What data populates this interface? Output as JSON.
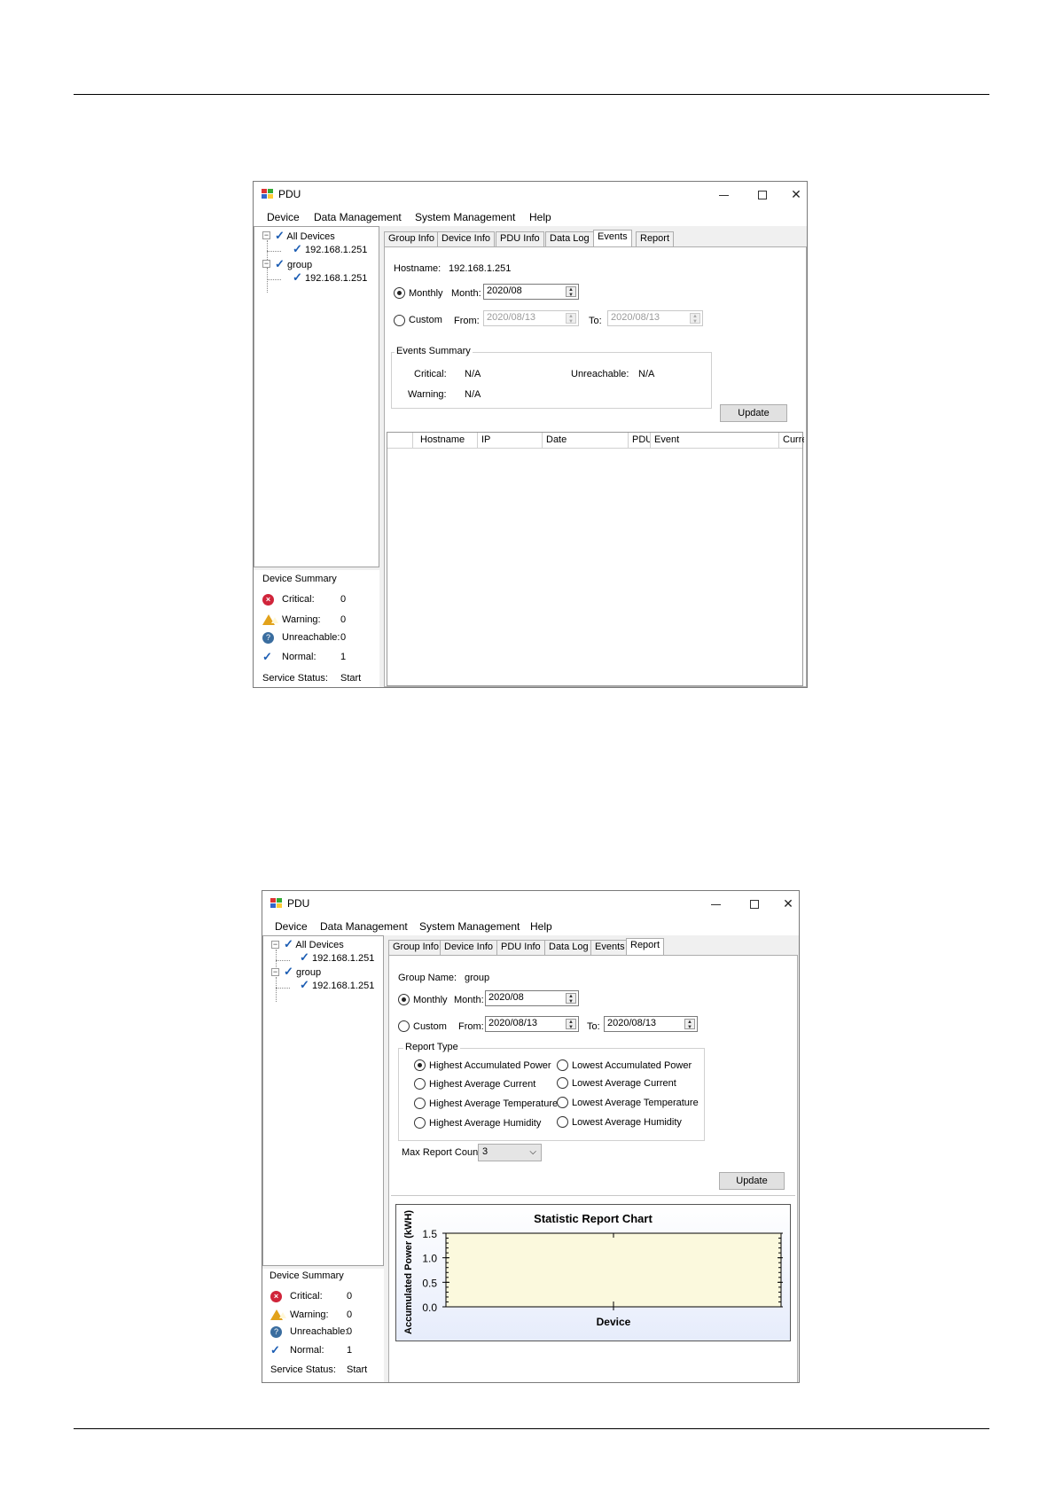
{
  "window": {
    "title": "PDU",
    "menu": [
      "Device",
      "Data Management",
      "System Management",
      "Help"
    ]
  },
  "tree": {
    "all_devices": "All Devices",
    "all_devices_child": "192.168.1.251",
    "group": "group",
    "group_child": "192.168.1.251"
  },
  "device_summary": {
    "title": "Device Summary",
    "critical_label": "Critical:",
    "critical_value": "0",
    "warning_label": "Warning:",
    "warning_value": "0",
    "unreachable_label": "Unreachable:",
    "unreachable_value": "0",
    "normal_label": "Normal:",
    "normal_value": "1",
    "service_label": "Service Status:",
    "service_value": "Start"
  },
  "tabs": [
    "Group Info",
    "Device Info",
    "PDU Info",
    "Data Log",
    "Events",
    "Report"
  ],
  "events_panel": {
    "hostname_label": "Hostname:",
    "hostname_value": "192.168.1.251",
    "monthly_label": "Monthly",
    "month_label": "Month:",
    "month_value": "2020/08",
    "custom_label": "Custom",
    "from_label": "From:",
    "from_value": "2020/08/13",
    "to_label": "To:",
    "to_value": "2020/08/13",
    "summary_title": "Events Summary",
    "critical_label": "Critical:",
    "critical_value": "N/A",
    "unreachable_label": "Unreachable:",
    "unreachable_value": "N/A",
    "warning_label": "Warning:",
    "warning_value": "N/A",
    "update_label": "Update",
    "columns": [
      "Hostname",
      "IP",
      "Date",
      "PDU",
      "Event",
      "Curre"
    ]
  },
  "report_panel": {
    "group_name_label": "Group Name:",
    "group_name_value": "group",
    "monthly_label": "Monthly",
    "month_label": "Month:",
    "month_value": "2020/08",
    "custom_label": "Custom",
    "from_label": "From:",
    "from_value": "2020/08/13",
    "to_label": "To:",
    "to_value": "2020/08/13",
    "report_type_title": "Report Type",
    "report_types": [
      "Highest Accumulated Power",
      "Lowest Accumulated Power",
      "Highest Average Current",
      "Lowest Average Current",
      "Highest Average Temperature",
      "Lowest Average Temperature",
      "Highest Average Humidity",
      "Lowest Average Humidity"
    ],
    "selected_report_type": "Highest Accumulated Power",
    "max_count_label": "Max Report Count:",
    "max_count_value": "3",
    "update_label": "Update"
  },
  "chart_data": {
    "type": "bar",
    "title": "Statistic Report Chart",
    "xlabel": "Device",
    "ylabel": "Accumulated Power (kWH)",
    "categories": [],
    "values": [],
    "ylim": [
      0.0,
      1.5
    ],
    "yticks": [
      "1.5",
      "1.0",
      "0.5",
      "0.0"
    ],
    "grid": false,
    "plot_color": "#fbf9dd"
  },
  "colors": {
    "check": "#1c5db3",
    "critical": "#d0243a",
    "warning": "#e2a21b",
    "unreachable": "#3a6d9f"
  }
}
